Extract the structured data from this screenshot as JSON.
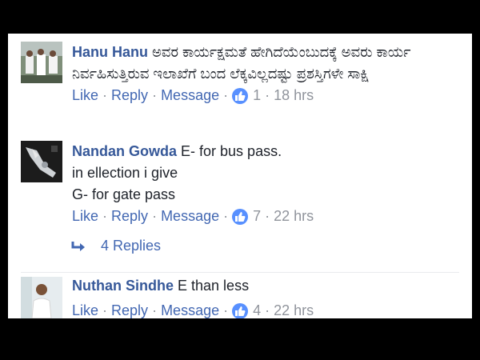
{
  "comments": [
    {
      "author": "Hanu Hanu",
      "text": "ಅವರ ಕಾರ್ಯಕ್ಷಮತೆ ಹೇಗಿದೆಯೆಂಬುದಕ್ಕೆ ಅವರು ಕಾರ್ಯ ನಿರ್ವಹಿಸುತ್ತಿರುವ ಇಲಾಖೆಗೆ ಬಂದ ಲೆಕ್ಕವಿಲ್ಲದಷ್ಟು ಪ್ರಶಸ್ತಿಗಳೇ ಸಾಕ್ಷಿ",
      "like": "Like",
      "reply": "Reply",
      "message": "Message",
      "likes": "1",
      "time": "18 hrs"
    },
    {
      "author": "Nandan Gowda",
      "text": "E- for bus pass.",
      "text2": "in ellection i give",
      "text3": "G- for gate pass",
      "like": "Like",
      "reply": "Reply",
      "message": "Message",
      "likes": "7",
      "time": "22 hrs"
    },
    {
      "author": "Nuthan Sindhe",
      "text": "E than less",
      "like": "Like",
      "reply": "Reply",
      "message": "Message",
      "likes": "4",
      "time": "22 hrs"
    }
  ],
  "replies_link": "4 Replies",
  "colors": {
    "author": "#365899",
    "link": "#4267b2",
    "like_badge": "#5890ff",
    "frame": "#000000"
  }
}
